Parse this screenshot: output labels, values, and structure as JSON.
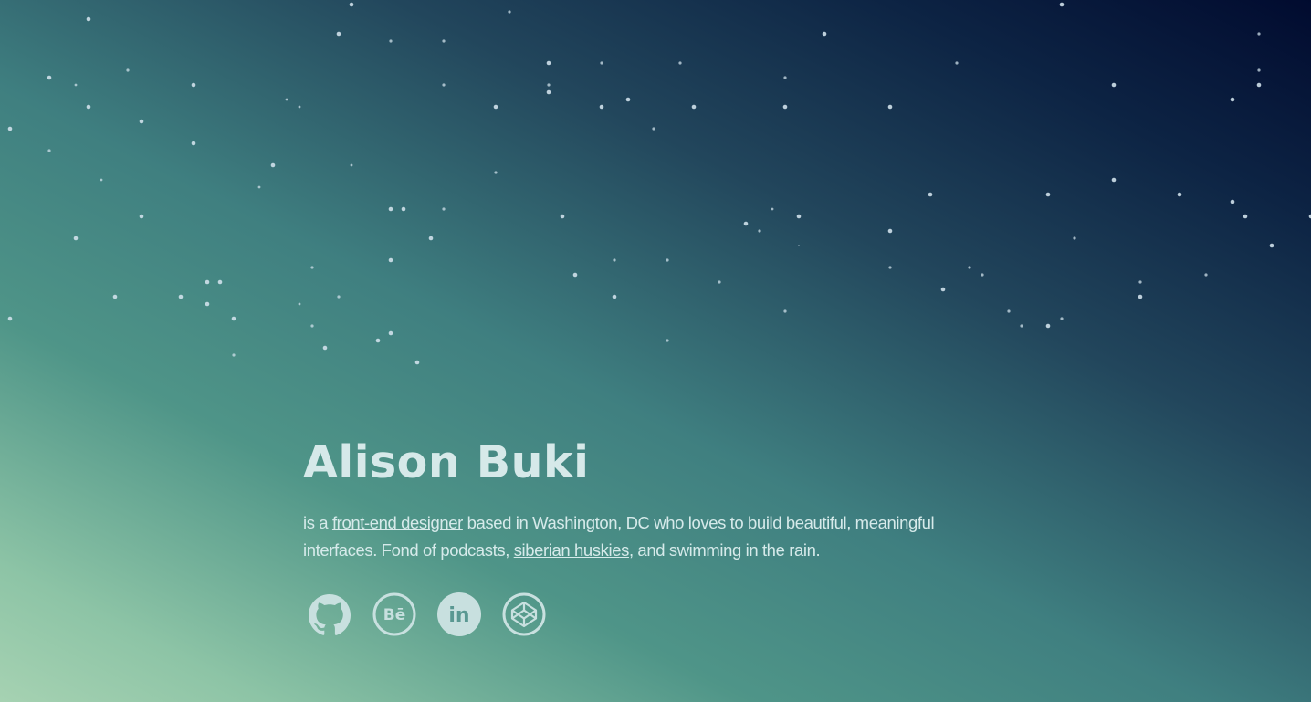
{
  "hero": {
    "name": "Alison Buki",
    "bio": {
      "prefix": "is a ",
      "link1": "front-end designer",
      "middle": " based in Washington, DC who loves to build beautiful, meaningful interfaces. Fond of podcasts, ",
      "link2": "siberian huskies",
      "suffix": ", and swimming in the rain."
    }
  },
  "social": [
    {
      "icon": "github-icon"
    },
    {
      "icon": "behance-icon"
    },
    {
      "icon": "linkedin-icon"
    },
    {
      "icon": "codepen-icon"
    }
  ],
  "colors": {
    "bg_top_right": "#010b2f",
    "bg_bottom_left": "#a6d2b2",
    "text": "#d6eaea",
    "star": "#cfe0ea"
  }
}
